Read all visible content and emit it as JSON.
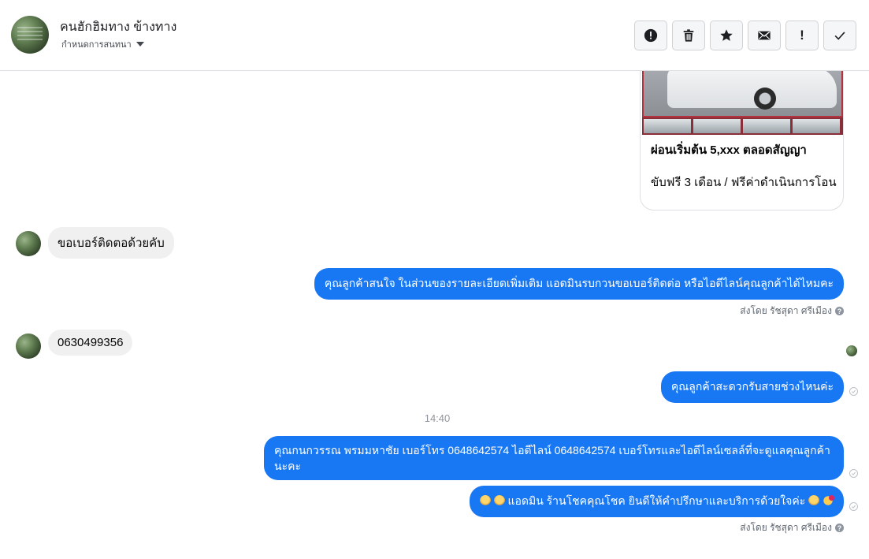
{
  "header": {
    "name": "คนฮักฮิมทาง ข้างทาง",
    "subtitle": "กำหนดการสนทนา"
  },
  "toolbar": {
    "buttons": [
      {
        "icon": "alert-circle-icon",
        "label": ""
      },
      {
        "icon": "trash-icon",
        "label": ""
      },
      {
        "icon": "star-icon",
        "label": ""
      },
      {
        "icon": "envelope-icon",
        "label": ""
      },
      {
        "icon": "exclamation-icon",
        "label": "!"
      },
      {
        "icon": "checkmark-icon",
        "label": ""
      }
    ]
  },
  "card": {
    "title": "ผ่อนเริ่มต้น 5,xxx ตลอดสัญญา",
    "description": "ขับฟรี 3 เดือน / ฟรีค่าดำเนินการโอน"
  },
  "messages": {
    "in1": "ขอเบอร์ติดตอด้วยคับ",
    "out1": "คุณลูกค้าสนใจ ในส่วนของรายละเอียดเพิ่มเติม แอดมินรบกวนขอเบอร์ติดต่อ หรือไอดีไลน์คุณลูกค้าได้ไหมคะ",
    "sent_by1": "ส่งโดย รัชสุดา ศรีเมือง",
    "in2": "0630499356",
    "out2": "คุณลูกค้าสะดวกรับสายช่วงไหนค่ะ",
    "time_separator": "14:40",
    "out3": "คุณกนกวรรณ พรมมหาชัย      เบอร์โทร 0648642574  ไอดีไลน์ 0648642574   เบอร์โทรและไอดีไลน์เซลล์ที่จะดูแลคุณลูกค้านะคะ",
    "out4": "แอดมิน ร้านโชคคุณโชค ยินดีให้คำปรึกษาและบริการด้วยใจค่ะ",
    "sent_by2": "ส่งโดย รัชสุดา ศรีเมือง",
    "help_glyph": "?"
  },
  "colors": {
    "outgoing_bubble": "#1877f2",
    "incoming_bubble": "#f0f0f0"
  }
}
